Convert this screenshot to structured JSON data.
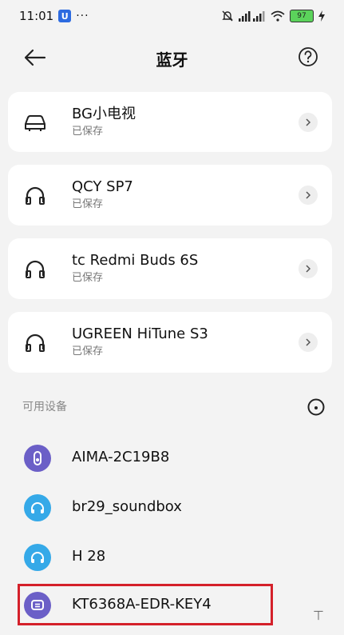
{
  "status_bar": {
    "time": "11:01",
    "app_badge": "U",
    "more": "···",
    "battery": "97"
  },
  "header": {
    "title": "蓝牙"
  },
  "saved_devices": [
    {
      "name": "BG小电视",
      "status": "已保存",
      "icon": "car-icon"
    },
    {
      "name": "QCY SP7",
      "status": "已保存",
      "icon": "headphones-icon"
    },
    {
      "name": "tc Redmi Buds 6S",
      "status": "已保存",
      "icon": "headphones-icon"
    },
    {
      "name": "UGREEN HiTune S3",
      "status": "已保存",
      "icon": "headphones-icon"
    }
  ],
  "available": {
    "section_title": "可用设备",
    "devices": [
      {
        "name": "AIMA-2C19B8",
        "icon": "scooter-icon",
        "color": "#6b5fc7"
      },
      {
        "name": "br29_soundbox",
        "icon": "headphones-icon",
        "color": "#35a9e8"
      },
      {
        "name": "H 28",
        "icon": "headphones-icon",
        "color": "#35a9e8"
      },
      {
        "name": "KT6368A-EDR-KEY4",
        "icon": "chat-icon",
        "color": "#6b5fc7"
      }
    ]
  },
  "colors": {
    "highlight": "#d4202a",
    "scooter": "#6b5fc7",
    "audio": "#35a9e8"
  }
}
